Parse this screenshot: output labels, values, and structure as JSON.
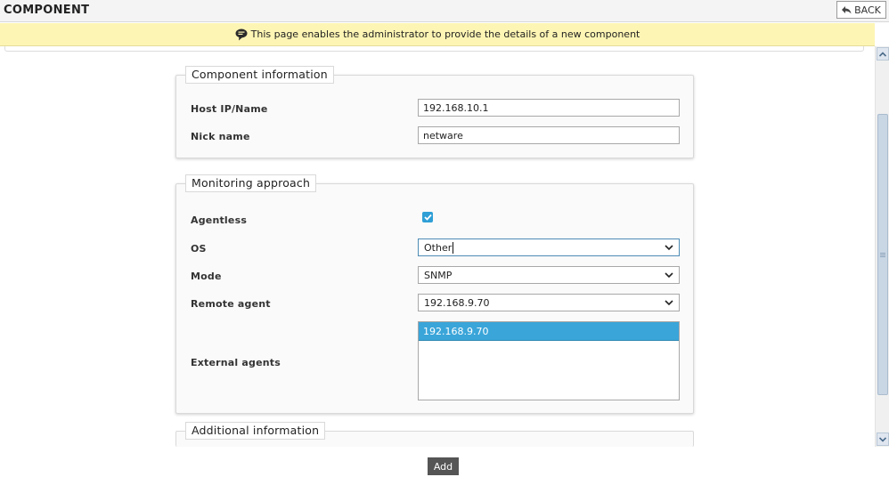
{
  "header": {
    "title": "COMPONENT",
    "back_label": "BACK"
  },
  "info_bar": {
    "icon": "speech-bubble-icon",
    "message": "This page enables the administrator to provide the details of a new component"
  },
  "sections": {
    "component_information": {
      "title": "Component information",
      "host_label": "Host IP/Name",
      "host_value": "192.168.10.1",
      "nick_label": "Nick name",
      "nick_value": "netware"
    },
    "monitoring_approach": {
      "title": "Monitoring approach",
      "agentless_label": "Agentless",
      "agentless_checked": true,
      "os_label": "OS",
      "os_value": "Other",
      "mode_label": "Mode",
      "mode_value": "SNMP",
      "remote_agent_label": "Remote agent",
      "remote_agent_value": "192.168.9.70",
      "external_agents_label": "External agents",
      "external_agents_options": [
        "192.168.9.70"
      ]
    },
    "additional_information": {
      "title": "Additional information"
    }
  },
  "actions": {
    "add_label": "Add"
  },
  "colors": {
    "info_bar_bg": "#fdf5b4",
    "accent": "#3aa5d9",
    "add_button_bg": "#555555"
  }
}
